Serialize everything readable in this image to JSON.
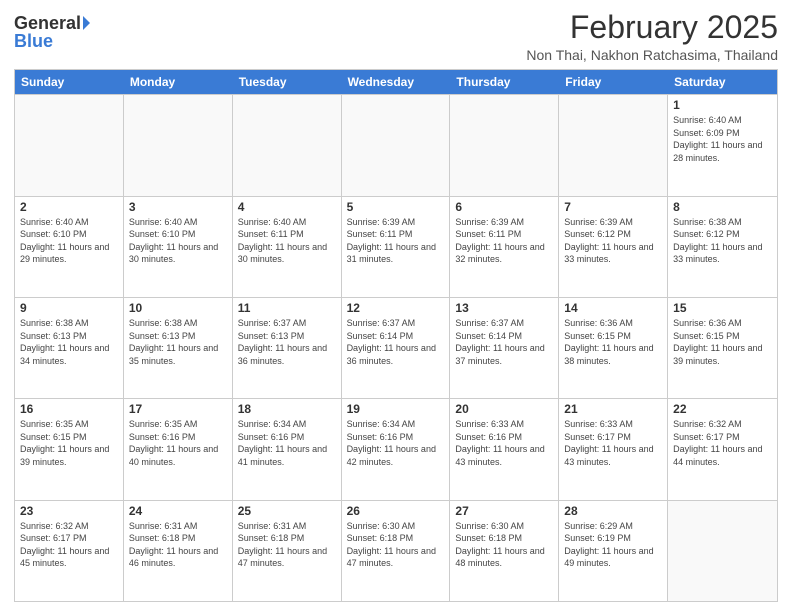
{
  "header": {
    "logo_general": "General",
    "logo_blue": "Blue",
    "month_year": "February 2025",
    "location": "Non Thai, Nakhon Ratchasima, Thailand"
  },
  "weekdays": [
    "Sunday",
    "Monday",
    "Tuesday",
    "Wednesday",
    "Thursday",
    "Friday",
    "Saturday"
  ],
  "weeks": [
    [
      {
        "day": "",
        "info": ""
      },
      {
        "day": "",
        "info": ""
      },
      {
        "day": "",
        "info": ""
      },
      {
        "day": "",
        "info": ""
      },
      {
        "day": "",
        "info": ""
      },
      {
        "day": "",
        "info": ""
      },
      {
        "day": "1",
        "info": "Sunrise: 6:40 AM\nSunset: 6:09 PM\nDaylight: 11 hours and 28 minutes."
      }
    ],
    [
      {
        "day": "2",
        "info": "Sunrise: 6:40 AM\nSunset: 6:10 PM\nDaylight: 11 hours and 29 minutes."
      },
      {
        "day": "3",
        "info": "Sunrise: 6:40 AM\nSunset: 6:10 PM\nDaylight: 11 hours and 30 minutes."
      },
      {
        "day": "4",
        "info": "Sunrise: 6:40 AM\nSunset: 6:11 PM\nDaylight: 11 hours and 30 minutes."
      },
      {
        "day": "5",
        "info": "Sunrise: 6:39 AM\nSunset: 6:11 PM\nDaylight: 11 hours and 31 minutes."
      },
      {
        "day": "6",
        "info": "Sunrise: 6:39 AM\nSunset: 6:11 PM\nDaylight: 11 hours and 32 minutes."
      },
      {
        "day": "7",
        "info": "Sunrise: 6:39 AM\nSunset: 6:12 PM\nDaylight: 11 hours and 33 minutes."
      },
      {
        "day": "8",
        "info": "Sunrise: 6:38 AM\nSunset: 6:12 PM\nDaylight: 11 hours and 33 minutes."
      }
    ],
    [
      {
        "day": "9",
        "info": "Sunrise: 6:38 AM\nSunset: 6:13 PM\nDaylight: 11 hours and 34 minutes."
      },
      {
        "day": "10",
        "info": "Sunrise: 6:38 AM\nSunset: 6:13 PM\nDaylight: 11 hours and 35 minutes."
      },
      {
        "day": "11",
        "info": "Sunrise: 6:37 AM\nSunset: 6:13 PM\nDaylight: 11 hours and 36 minutes."
      },
      {
        "day": "12",
        "info": "Sunrise: 6:37 AM\nSunset: 6:14 PM\nDaylight: 11 hours and 36 minutes."
      },
      {
        "day": "13",
        "info": "Sunrise: 6:37 AM\nSunset: 6:14 PM\nDaylight: 11 hours and 37 minutes."
      },
      {
        "day": "14",
        "info": "Sunrise: 6:36 AM\nSunset: 6:15 PM\nDaylight: 11 hours and 38 minutes."
      },
      {
        "day": "15",
        "info": "Sunrise: 6:36 AM\nSunset: 6:15 PM\nDaylight: 11 hours and 39 minutes."
      }
    ],
    [
      {
        "day": "16",
        "info": "Sunrise: 6:35 AM\nSunset: 6:15 PM\nDaylight: 11 hours and 39 minutes."
      },
      {
        "day": "17",
        "info": "Sunrise: 6:35 AM\nSunset: 6:16 PM\nDaylight: 11 hours and 40 minutes."
      },
      {
        "day": "18",
        "info": "Sunrise: 6:34 AM\nSunset: 6:16 PM\nDaylight: 11 hours and 41 minutes."
      },
      {
        "day": "19",
        "info": "Sunrise: 6:34 AM\nSunset: 6:16 PM\nDaylight: 11 hours and 42 minutes."
      },
      {
        "day": "20",
        "info": "Sunrise: 6:33 AM\nSunset: 6:16 PM\nDaylight: 11 hours and 43 minutes."
      },
      {
        "day": "21",
        "info": "Sunrise: 6:33 AM\nSunset: 6:17 PM\nDaylight: 11 hours and 43 minutes."
      },
      {
        "day": "22",
        "info": "Sunrise: 6:32 AM\nSunset: 6:17 PM\nDaylight: 11 hours and 44 minutes."
      }
    ],
    [
      {
        "day": "23",
        "info": "Sunrise: 6:32 AM\nSunset: 6:17 PM\nDaylight: 11 hours and 45 minutes."
      },
      {
        "day": "24",
        "info": "Sunrise: 6:31 AM\nSunset: 6:18 PM\nDaylight: 11 hours and 46 minutes."
      },
      {
        "day": "25",
        "info": "Sunrise: 6:31 AM\nSunset: 6:18 PM\nDaylight: 11 hours and 47 minutes."
      },
      {
        "day": "26",
        "info": "Sunrise: 6:30 AM\nSunset: 6:18 PM\nDaylight: 11 hours and 47 minutes."
      },
      {
        "day": "27",
        "info": "Sunrise: 6:30 AM\nSunset: 6:18 PM\nDaylight: 11 hours and 48 minutes."
      },
      {
        "day": "28",
        "info": "Sunrise: 6:29 AM\nSunset: 6:19 PM\nDaylight: 11 hours and 49 minutes."
      },
      {
        "day": "",
        "info": ""
      }
    ]
  ]
}
